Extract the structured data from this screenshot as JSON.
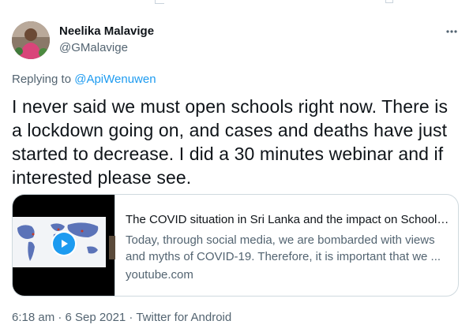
{
  "tweet": {
    "author": {
      "display_name": "Neelika Malavige",
      "handle": "@GMalavige",
      "avatar": "avatar"
    },
    "more_icon": "more-horizontal-icon",
    "replying_prefix": "Replying to",
    "replying_to": "@ApiWenuwen",
    "text": "I never said we must open schools right now. There is a lockdown going on, and cases and deaths have just started to decrease. I did a 30 minutes webinar and if interested please see.",
    "card": {
      "title": "The COVID situation in Sri Lanka and the impact on Schooli...",
      "description": "Today, through social media, we are bombarded with views and myths of COVID-19. Therefore, it is important that we ...",
      "domain": "youtube.com",
      "play_icon": "play-icon"
    },
    "meta": {
      "timestamp": "6:18 am · 6 Sep 2021",
      "separator": " · ",
      "source": "Twitter for Android"
    }
  },
  "colors": {
    "text_primary": "#0f1419",
    "text_secondary": "#536471",
    "accent": "#1d9bf0",
    "border": "#cfd9de"
  }
}
